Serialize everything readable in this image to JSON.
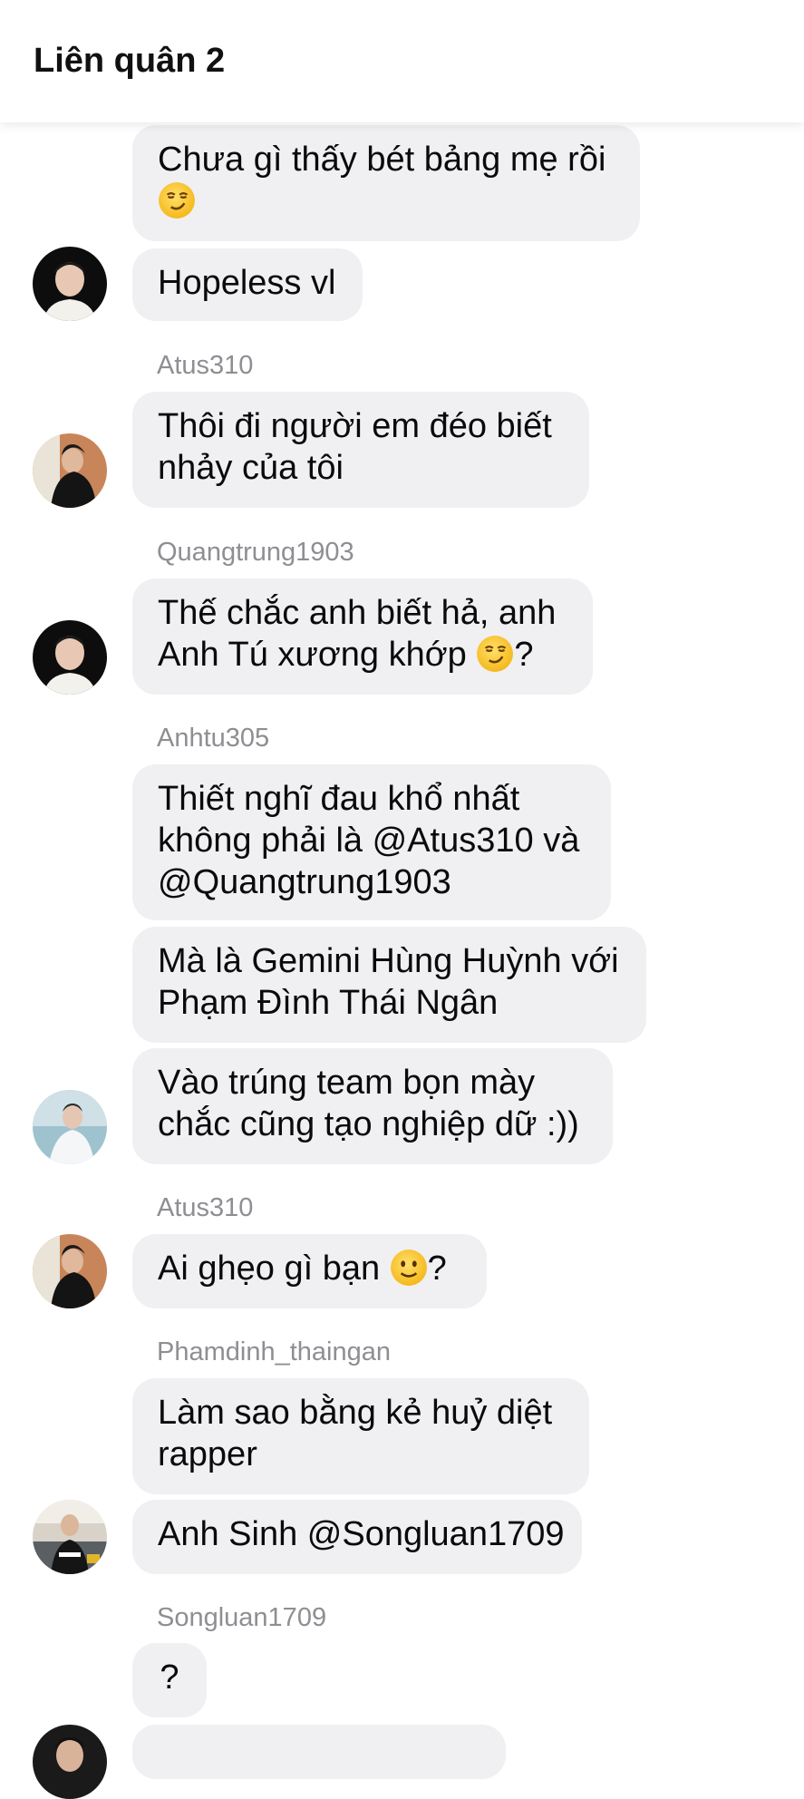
{
  "header": {
    "title": "Liên quân 2"
  },
  "messages": [
    {
      "lines": [
        "Chưa gì thấy bét bảng mẹ rồi"
      ],
      "emoji": "smirk-emoji"
    },
    {
      "lines": [
        "Hopeless vl"
      ]
    },
    {
      "sender": "Atus310",
      "lines": [
        "Thôi đi người em đéo biết",
        "nhảy của tôi"
      ]
    },
    {
      "sender": "Quangtrung1903",
      "lines": [
        "Thế chắc anh biết hả, anh",
        "Anh Tú xương khớp "
      ],
      "suffix": "?",
      "emoji": "smirk-emoji"
    },
    {
      "sender": "Anhtu305",
      "lines": [
        "Thiết nghĩ đau khổ nhất",
        "không phải là @Atus310 và",
        "@Quangtrung1903"
      ]
    },
    {
      "lines": [
        "Mà là Gemini Hùng Huỳnh với",
        "Phạm Đình Thái Ngân"
      ]
    },
    {
      "lines": [
        "Vào trúng team bọn mày",
        "chắc cũng tạo nghiệp dữ :))"
      ]
    },
    {
      "sender": "Atus310",
      "lines": [
        "Ai ghẹo gì bạn "
      ],
      "suffix": "?",
      "emoji": "slight-smile-emoji"
    },
    {
      "sender": "Phamdinh_thaingan",
      "lines": [
        "Làm sao bằng kẻ huỷ diệt",
        "rapper"
      ]
    },
    {
      "lines": [
        "Anh Sinh @Songluan1709"
      ]
    },
    {
      "sender": "Songluan1709",
      "lines": [
        "?"
      ]
    }
  ],
  "avatars": [
    {
      "name": "avatar-user-white-shirt"
    },
    {
      "name": "avatar-atus310"
    },
    {
      "name": "avatar-user-white-shirt"
    },
    {
      "name": "avatar-anhtu305"
    },
    {
      "name": "avatar-atus310"
    },
    {
      "name": "avatar-phamdinh-thaingan"
    },
    {
      "name": "avatar-songluan1709"
    }
  ],
  "colors": {
    "bubble": "#f0f0f3",
    "sender": "#8e8e93",
    "emoji": "#f9c623"
  }
}
